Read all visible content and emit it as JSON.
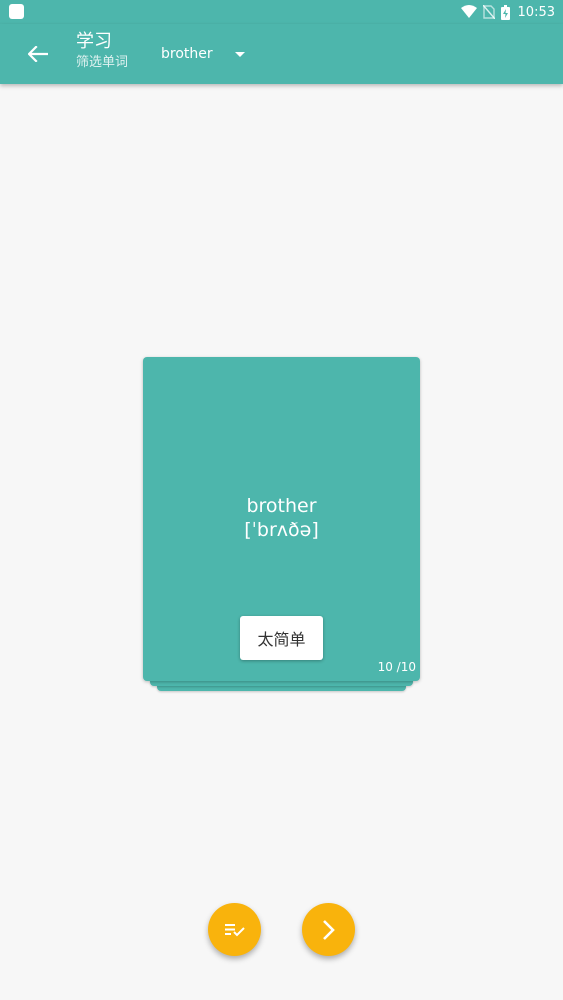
{
  "status_bar": {
    "time": "10:53",
    "icons": [
      "app-notification-icon",
      "wifi-icon",
      "no-sim-icon",
      "battery-charging-icon"
    ]
  },
  "app_bar": {
    "title": "学习",
    "subtitle": "筛选单词",
    "selected_word": "brother",
    "back_icon": "arrow-left-icon",
    "dropdown_icon": "caret-down-icon"
  },
  "card": {
    "word": "brother",
    "phonetic": "[ˈbrʌðə]",
    "too_easy_label": "太简单",
    "progress": "10 /10"
  },
  "fabs": {
    "list_icon": "list-check-icon",
    "next_icon": "chevron-right-icon"
  },
  "colors": {
    "primary": "#4db6ac",
    "accent": "#f9b30c",
    "background": "#f7f7f7"
  }
}
